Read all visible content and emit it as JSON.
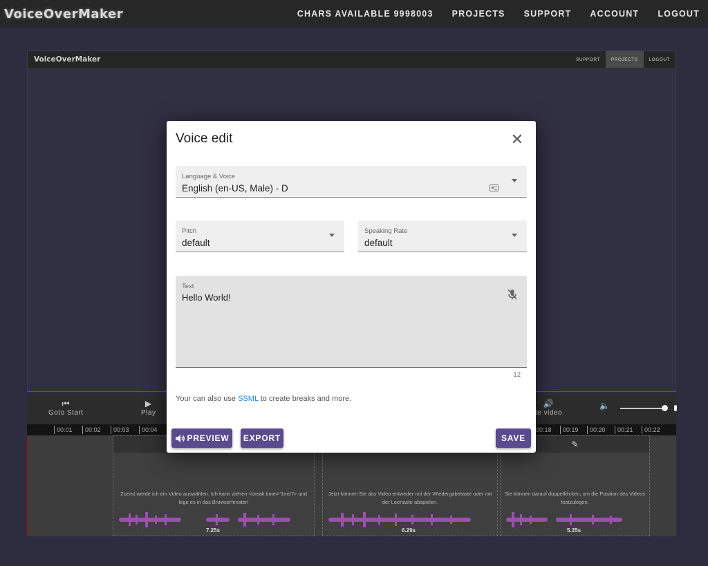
{
  "app": {
    "logo": "VoiceOverMaker",
    "nav": {
      "chars_available": "CHARS AVAILABLE 9998003",
      "projects": "PROJECTS",
      "support": "SUPPORT",
      "account": "ACCOUNT",
      "logout": "LOGOUT"
    }
  },
  "preview_frame": {
    "logo": "VoiceOverMaker",
    "links": {
      "support": "SUPPORT",
      "projects": "PROJECTS",
      "logout": "LOGOUT"
    }
  },
  "controls": {
    "goto_start": "Goto Start",
    "play": "Play",
    "mute_video": "te video",
    "volume_level": 0.95
  },
  "ruler": [
    "00:01",
    "00:02",
    "00:03",
    "00:04",
    "00:18",
    "00:19",
    "00:20",
    "00:21",
    "00:22"
  ],
  "timeline": {
    "clips": [
      {
        "text": "Zuerst werde ich ein Video auswählen. Ich kann ziehen <break time=\"1ms\"/> und lege es in das Browserfenster!",
        "duration": "7.25s"
      },
      {
        "text": "Jetzt können Sie das Video entweder mit der Wiedergabetaste oder mit der Leertaste abspielen.",
        "duration": "6.29s"
      },
      {
        "text": "Sie können darauf doppelklicken, um die Position des Videos festzulegen.",
        "duration": "5.35s"
      }
    ]
  },
  "modal": {
    "title": "Voice edit",
    "language_voice": {
      "label": "Language & Voice",
      "value": "English (en-US, Male) - D"
    },
    "pitch": {
      "label": "Pitch",
      "value": "default"
    },
    "speaking_rate": {
      "label": "Speaking Rate",
      "value": "default"
    },
    "text": {
      "label": "Text",
      "value": "Hello World!",
      "count": "12"
    },
    "hint_before": "Your can also use ",
    "hint_link": "SSML",
    "hint_after": " to create breaks and more.",
    "buttons": {
      "preview": "PREVIEW",
      "export": "EXPORT",
      "save": "SAVE"
    }
  },
  "colors": {
    "accent": "#5a4a8e",
    "link": "#1e88e5",
    "waveform": "#9b4fb0",
    "background": "#2e2c3f"
  }
}
